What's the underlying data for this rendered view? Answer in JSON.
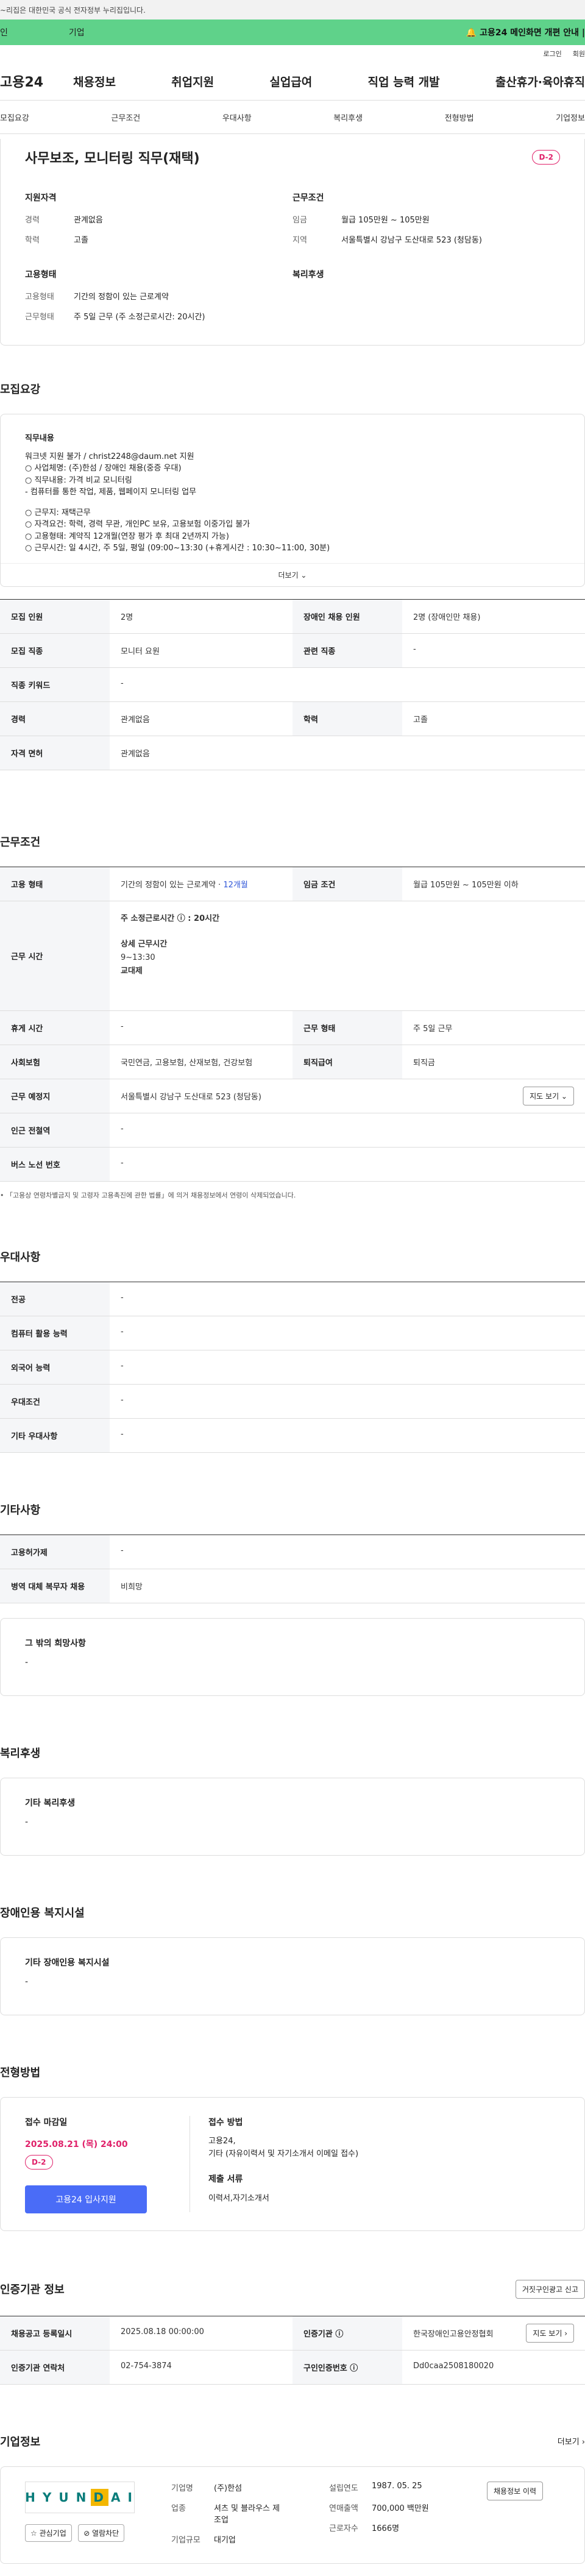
{
  "gov_bar": "~리집은 대한민국 공식 전자정부 누리집입니다.",
  "banner": {
    "left_label": "인",
    "mid_label": "기업",
    "right_text": "🔔 고용24 메인화면 개편 안내 |"
  },
  "util": {
    "login": "로그인",
    "join": "회원"
  },
  "gnb": {
    "logo": "고용24",
    "menu": [
      "채용정보",
      "취업지원",
      "실업급여",
      "직업 능력 개발",
      "출산휴가·육아휴직"
    ]
  },
  "tabs": [
    "모집요강",
    "근무조건",
    "우대사항",
    "복리후생",
    "전형방법",
    "기업정보"
  ],
  "summary": {
    "title": "사무보조, 모니터링 직무(재택)",
    "dday": "D-2",
    "qual": {
      "heading": "지원자격",
      "rows": [
        {
          "k": "경력",
          "v": "관계없음"
        },
        {
          "k": "학력",
          "v": "고졸"
        }
      ]
    },
    "cond": {
      "heading": "근무조건",
      "rows": [
        {
          "k": "임금",
          "v": "월급 105만원 ~ 105만원"
        },
        {
          "k": "지역",
          "v": "서울특별시 강남구 도산대로 523 (청담동)"
        }
      ]
    },
    "emp": {
      "heading": "고용형태",
      "rows": [
        {
          "k": "고용형태",
          "v": "기간의 정함이 있는 근로계약"
        },
        {
          "k": "근무형태",
          "v": "주 5일 근무 (주 소정근로시간: 20시간)"
        }
      ]
    },
    "welfare_heading": "복리후생"
  },
  "recruit": {
    "title": "모집요강",
    "detail_heading": "직무내용",
    "detail_lines": [
      "워크넷 지원 불가 / christ2248@daum.net 지원",
      "○ 사업체명: (주)한섬 / 장애인 채용(중증 우대)",
      "○ 직무내용: 가격 비교 모니터링",
      "- 컴퓨터를 통한 작업, 제품, 웹페이지 모니터링 업무",
      "",
      "○ 근무지: 재택근무",
      "○ 자격요건: 학력, 경력 무관, 개인PC 보유, 고용보험 이중가입 불가",
      "○ 고용형태: 계약직 12개월(연장 평가 후 최대 2년까지 가능)",
      "○ 근무시간: 일 4시간, 주 5일, 평일 (09:00~13:30 (+휴게시간 : 10:30~11:00, 30분)"
    ],
    "more": "더보기 ⌄",
    "rows": [
      {
        "k1": "모집 인원",
        "v1": "2명",
        "k2": "장애인 채용 인원",
        "v2": "2명 (장애인만 채용)"
      },
      {
        "k1": "모집 직종",
        "v1": "모니터 요원",
        "k2": "관련 직종",
        "v2": "-"
      },
      {
        "k1": "직종 키워드",
        "v1": "-"
      },
      {
        "k1": "경력",
        "v1": "관계없음",
        "k2": "학력",
        "v2": "고졸"
      },
      {
        "k1": "자격 면허",
        "v1": "관계없음"
      }
    ]
  },
  "work": {
    "title": "근무조건",
    "emp_type_k": "고용 형태",
    "emp_type_v": "기간의 정함이 있는 근로계약 ·",
    "emp_type_months": "12개월",
    "wage_k": "임금 조건",
    "wage_v": "월급 105만원 ~ 105만원 이하",
    "hours_k": "근무 시간",
    "hours_main": "주 소정근로시간 ⓘ : 20시간",
    "hours_detail_label": "상세 근무시간",
    "hours_detail": "9~13:30",
    "hours_shift": "교대제",
    "rest_k": "휴게 시간",
    "rest_v": "-",
    "form_k": "근무 형태",
    "form_v": "주 5일 근무",
    "ins_k": "사회보험",
    "ins_v": "국민연금, 고용보험, 산재보험, 건강보험",
    "sev_k": "퇴직급여",
    "sev_v": "퇴직금",
    "loc_k": "근무 예정지",
    "loc_v": "서울특별시 강남구 도산대로 523 (청담동)",
    "map_btn": "지도 보기 ⌄",
    "subway_k": "인근 전철역",
    "subway_v": "-",
    "bus_k": "버스 노선 번호",
    "bus_v": "-",
    "note": "• 「고용상 연령차별금지 및 고령자 고용촉진에 관한 법률」에 의거 채용정보에서 연령이 삭제되었습니다."
  },
  "pref": {
    "title": "우대사항",
    "rows": [
      {
        "k": "전공",
        "v": "-"
      },
      {
        "k": "컴퓨터 활용 능력",
        "v": "-"
      },
      {
        "k": "외국어 능력",
        "v": "-"
      },
      {
        "k": "우대조건",
        "v": "-"
      },
      {
        "k": "기타 우대사항",
        "v": "-"
      }
    ]
  },
  "etc": {
    "title": "기타사항",
    "rows": [
      {
        "k": "고용허가제",
        "v": "-"
      },
      {
        "k": "병역 대체 복무자 채용",
        "v": "비희망"
      }
    ],
    "wish_heading": "그 밖의 희망사항",
    "wish_value": "-"
  },
  "welfare": {
    "title": "복리후생",
    "heading": "기타 복리후생",
    "value": "-"
  },
  "disabled": {
    "title": "장애인용 복지시설",
    "heading": "기타 장애인용 복지시설",
    "value": "-"
  },
  "process": {
    "title": "전형방법",
    "deadline_label": "접수 마감일",
    "deadline": "2025.08.21 (목) 24:00",
    "dday": "D-2",
    "apply_btn": "고용24 입사지원",
    "method_label": "접수 방법",
    "method_lines": [
      "고용24,",
      "기타 (자유이력서 및 자기소개서 이메일 접수)"
    ],
    "docs_label": "제출 서류",
    "docs": "이력서,자기소개서"
  },
  "cert": {
    "title": "인증기관 정보",
    "report_btn": "거짓구인광고 신고",
    "reg_k": "채용공고 등록일시",
    "reg_v": "2025.08.18 00:00:00",
    "org_k": "인증기관 ⓘ",
    "org_v": "한국장애인고용안정협회",
    "map_btn": "지도 보기 ›",
    "tel_k": "인증기관 연락처",
    "tel_v": "02-754-3874",
    "no_k": "구인인증번호 ⓘ",
    "no_v": "Dd0caa2508180020"
  },
  "company": {
    "title": "기업정보",
    "more": "더보기 ›",
    "logo_letters": [
      "H",
      "Y",
      "U",
      "N",
      "D",
      "A",
      "I"
    ],
    "logo_sub": "HANDSOME",
    "fav_btn": "☆ 관심기업",
    "block_btn": "⊘ 열람차단",
    "name_k": "기업명",
    "name_v": "(주)한섬",
    "ind_k": "업종",
    "ind_v": "셔츠 및 블라우스 제조업",
    "size_k": "기업규모",
    "size_v": "대기업",
    "est_k": "설립연도",
    "est_v": "1987. 05. 25",
    "sales_k": "연매출액",
    "sales_v": "700,000 백만원",
    "emp_k": "근로자수",
    "emp_v": "1666명",
    "jobs_btn": "채용정보 이력"
  }
}
